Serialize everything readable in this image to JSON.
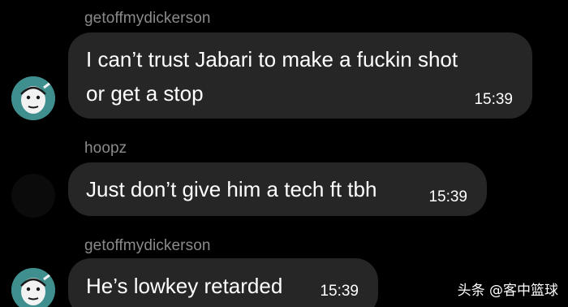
{
  "messages": [
    {
      "sender": "getoffmydickerson",
      "lines": [
        "I can’t trust Jabari to make a fuckin shot",
        "or get a stop"
      ],
      "time": "15:39",
      "avatar": "cartoon-face-avatar"
    },
    {
      "sender": "hoopz",
      "lines": [
        "Just don’t give him a tech ft tbh"
      ],
      "time": "15:39",
      "avatar": "empty-avatar"
    },
    {
      "sender": "getoffmydickerson",
      "lines": [
        "He’s lowkey retarded"
      ],
      "time": "15:39",
      "avatar": "cartoon-face-avatar"
    }
  ],
  "watermark": "头条 @客中篮球",
  "colors": {
    "background": "#000000",
    "bubble": "#262626",
    "sender": "#8a8a8a",
    "avatar": "#3f8f8e"
  }
}
